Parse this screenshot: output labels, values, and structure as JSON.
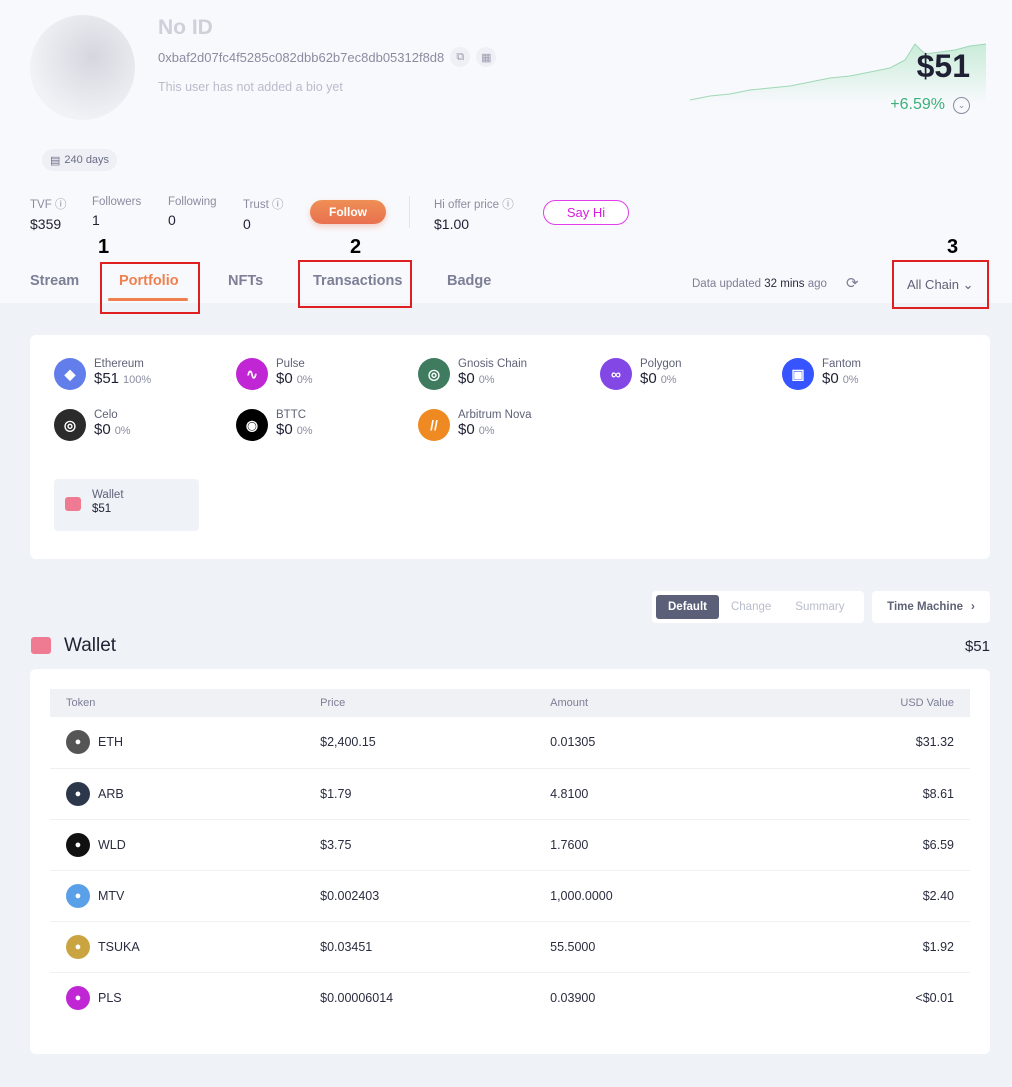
{
  "profile": {
    "name": "No ID",
    "address": "0xbaf2d07fc4f5285c082dbb62b7ec8db05312f8d8",
    "bio": "This user has not added a bio yet",
    "days": "240 days"
  },
  "net_worth": {
    "value": "$51",
    "change": "+6.59%",
    "positive_color": "#3bb07a"
  },
  "stats": [
    {
      "label": "TVF",
      "value": "$359",
      "help": true
    },
    {
      "label": "Followers",
      "value": "1"
    },
    {
      "label": "Following",
      "value": "0"
    },
    {
      "label": "Trust",
      "value": "0",
      "help": true
    }
  ],
  "follow_label": "Follow",
  "hi_offer": {
    "label": "Hi offer price",
    "value": "$1.00"
  },
  "say_hi_label": "Say Hi",
  "tabs": [
    {
      "label": "Stream"
    },
    {
      "label": "Portfolio",
      "active": true
    },
    {
      "label": "NFTs"
    },
    {
      "label": "Transactions"
    },
    {
      "label": "Badge"
    }
  ],
  "annotations": [
    "1",
    "2",
    "3"
  ],
  "data_updated": {
    "prefix": "Data updated",
    "time": "32 mins",
    "suffix": "ago"
  },
  "chain_select": "All Chain",
  "chains": [
    {
      "name": "Ethereum",
      "value": "$51",
      "pct": "100%",
      "color": "#627eea",
      "glyph": "◆"
    },
    {
      "name": "Pulse",
      "value": "$0",
      "pct": "0%",
      "color": "#c026d3",
      "glyph": "∿"
    },
    {
      "name": "Gnosis Chain",
      "value": "$0",
      "pct": "0%",
      "color": "#3e7b5f",
      "glyph": "◎"
    },
    {
      "name": "Polygon",
      "value": "$0",
      "pct": "0%",
      "color": "#8247e5",
      "glyph": "∞"
    },
    {
      "name": "Fantom",
      "value": "$0",
      "pct": "0%",
      "color": "#3654ff",
      "glyph": "▣"
    },
    {
      "name": "Celo",
      "value": "$0",
      "pct": "0%",
      "color": "#2b2b2b",
      "glyph": "◎"
    },
    {
      "name": "BTTC",
      "value": "$0",
      "pct": "0%",
      "color": "#000000",
      "glyph": "◉"
    },
    {
      "name": "Arbitrum Nova",
      "value": "$0",
      "pct": "0%",
      "color": "#ef8a22",
      "glyph": "//"
    }
  ],
  "wallet_summary": {
    "label": "Wallet",
    "value": "$51"
  },
  "view_toggle": {
    "options": [
      "Default",
      "Change",
      "Summary"
    ],
    "active": "Default"
  },
  "time_machine": "Time Machine",
  "wallet": {
    "title": "Wallet",
    "total": "$51",
    "columns": [
      "Token",
      "Price",
      "Amount",
      "USD Value"
    ],
    "rows": [
      {
        "token": "ETH",
        "price": "$2,400.15",
        "amount": "0.01305",
        "usd": "$31.32",
        "color": "#555"
      },
      {
        "token": "ARB",
        "price": "$1.79",
        "amount": "4.8100",
        "usd": "$8.61",
        "color": "#2d374b"
      },
      {
        "token": "WLD",
        "price": "$3.75",
        "amount": "1.7600",
        "usd": "$6.59",
        "color": "#111"
      },
      {
        "token": "MTV",
        "price": "$0.002403",
        "amount": "1,000.0000",
        "usd": "$2.40",
        "color": "#5aa0e8"
      },
      {
        "token": "TSUKA",
        "price": "$0.03451",
        "amount": "55.5000",
        "usd": "$1.92",
        "color": "#c9a440"
      },
      {
        "token": "PLS",
        "price": "$0.00006014",
        "amount": "0.03900",
        "usd": "<$0.01",
        "color": "#c026d3"
      }
    ]
  }
}
